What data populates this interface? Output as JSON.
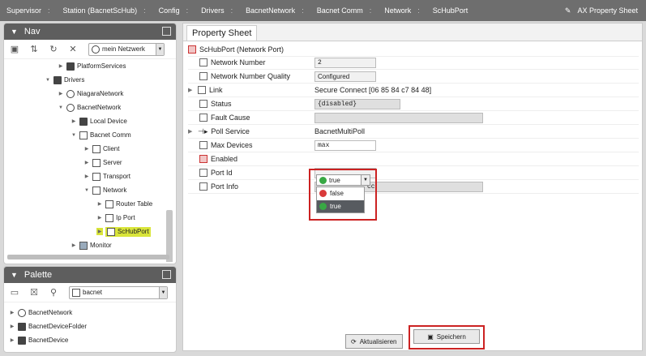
{
  "breadcrumb": [
    "Supervisor",
    "Station (BacnetScHub)",
    "Config",
    "Drivers",
    "BacnetNetwork",
    "Bacnet Comm",
    "Network",
    "ScHubPort"
  ],
  "view_selector": "AX Property Sheet",
  "nav": {
    "title": "Nav",
    "network_select": "mein Netzwerk",
    "tree": [
      {
        "label": "PlatformServices"
      },
      {
        "label": "Drivers"
      },
      {
        "label": "NiagaraNetwork"
      },
      {
        "label": "BacnetNetwork"
      },
      {
        "label": "Local Device"
      },
      {
        "label": "Bacnet Comm"
      },
      {
        "label": "Client"
      },
      {
        "label": "Server"
      },
      {
        "label": "Transport"
      },
      {
        "label": "Network"
      },
      {
        "label": "Router Table"
      },
      {
        "label": "Ip Port"
      },
      {
        "label": "ScHubPort"
      },
      {
        "label": "Monitor"
      }
    ]
  },
  "palette": {
    "title": "Palette",
    "module_select": "bacnet",
    "items": [
      "BacnetNetwork",
      "BacnetDeviceFolder",
      "BacnetDevice"
    ]
  },
  "sheet": {
    "tab": "Property Sheet",
    "header": "ScHubPort  (Network Port)",
    "rows": [
      {
        "label": "Network Number",
        "value": "2"
      },
      {
        "label": "Network Number Quality",
        "value": "Configured"
      },
      {
        "label": "Link",
        "value": "Secure Connect [06 85 84 c7 84 48]"
      },
      {
        "label": "Status",
        "value": "{disabled}"
      },
      {
        "label": "Fault Cause",
        "value": ""
      },
      {
        "label": "Poll Service",
        "value": "BacnetMultiPoll"
      },
      {
        "label": "Max Devices",
        "value": "max"
      },
      {
        "label": "Enabled",
        "value": "true"
      },
      {
        "label": "Port Id",
        "value": ""
      },
      {
        "label": "Port Info",
        "value": "cc"
      }
    ],
    "enabled_options": [
      "false",
      "true"
    ]
  },
  "buttons": {
    "refresh": "Aktualisieren",
    "save": "Speichern"
  },
  "colors": {
    "highlight_frame": "#cc2222",
    "selected_tree": "#d9e53a"
  }
}
